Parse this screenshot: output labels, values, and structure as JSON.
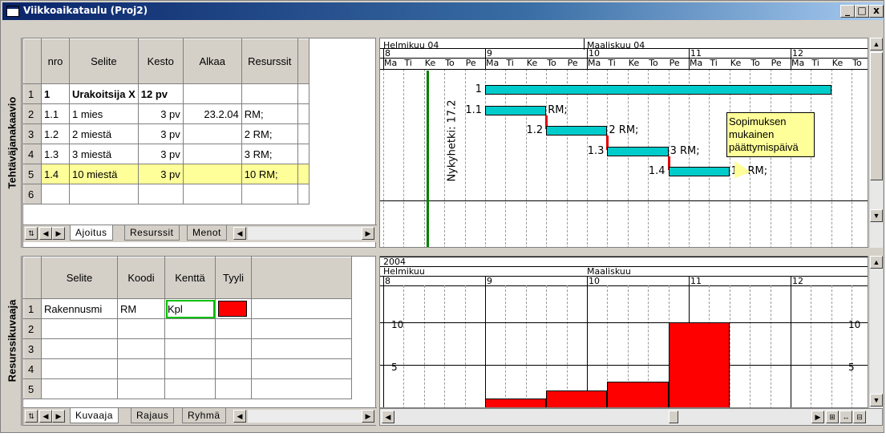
{
  "window": {
    "title": "Viikkoaikataulu (Proj2)",
    "min": "_",
    "max": "□",
    "close": "x"
  },
  "top": {
    "side_label": "Tehtäväjanakaavio",
    "columns": [
      "nro",
      "Selite",
      "Kesto",
      "Alkaa",
      "Resurssit"
    ],
    "rows": [
      {
        "id": "1",
        "nro": "1",
        "selite": "Urakoitsija X",
        "kesto": "12 pv",
        "alkaa": "",
        "res": ""
      },
      {
        "id": "2",
        "nro": "1.1",
        "selite": "1 mies",
        "kesto": "3 pv",
        "alkaa": "23.2.04",
        "res": "RM;"
      },
      {
        "id": "3",
        "nro": "1.2",
        "selite": "2 miestä",
        "kesto": "3 pv",
        "alkaa": "",
        "res": "2 RM;"
      },
      {
        "id": "4",
        "nro": "1.3",
        "selite": "3 miestä",
        "kesto": "3 pv",
        "alkaa": "",
        "res": "3 RM;"
      },
      {
        "id": "5",
        "nro": "1.4",
        "selite": "10 miestä",
        "kesto": "3 pv",
        "alkaa": "",
        "res": "10 RM;"
      },
      {
        "id": "6",
        "nro": "",
        "selite": "",
        "kesto": "",
        "alkaa": "",
        "res": ""
      }
    ],
    "tabs": [
      "Ajoitus",
      "Resurssit",
      "Menot"
    ],
    "gantt": {
      "months": [
        "Helmikuu 04",
        "Maaliskuu 04"
      ],
      "weeks": [
        "8",
        "9",
        "10",
        "11",
        "12"
      ],
      "days": [
        "Ma",
        "Ti",
        "Ke",
        "To",
        "Pe"
      ],
      "now_label": "Nykyhetki: 17.2",
      "bars": [
        {
          "label": "1",
          "res": ""
        },
        {
          "label": "1.1",
          "res": "RM;"
        },
        {
          "label": "1.2",
          "res": "2 RM;"
        },
        {
          "label": "1.3",
          "res": "3 RM;"
        },
        {
          "label": "1.4",
          "res": "10 RM;"
        }
      ],
      "callout": "Sopimuksen mukainen päättymispäivä"
    }
  },
  "bottom": {
    "side_label": "Resurssikuvaaja",
    "columns": [
      "Selite",
      "Koodi",
      "Kenttä",
      "Tyyli"
    ],
    "rows": [
      {
        "id": "1",
        "selite": "Rakennusmi",
        "koodi": "RM",
        "kentta": "Kpl",
        "tyyli_color": "#ff0000"
      },
      {
        "id": "2",
        "selite": "",
        "koodi": "",
        "kentta": ""
      },
      {
        "id": "3",
        "selite": "",
        "koodi": "",
        "kentta": ""
      },
      {
        "id": "4",
        "selite": "",
        "koodi": "",
        "kentta": ""
      },
      {
        "id": "5",
        "selite": "",
        "koodi": "",
        "kentta": ""
      }
    ],
    "tabs": [
      "Kuvaaja",
      "Rajaus",
      "Ryhmä"
    ],
    "chart": {
      "year": "2004",
      "months": [
        "Helmikuu",
        "Maaliskuu"
      ],
      "weeks": [
        "8",
        "9",
        "10",
        "11",
        "12"
      ],
      "ytick_10": "10",
      "ytick_5": "5"
    }
  },
  "chart_data": {
    "type": "bar",
    "categories": [
      "9",
      "10",
      "11"
    ],
    "values": [
      1,
      2,
      3,
      10
    ],
    "ylabel": "",
    "ylim": [
      0,
      12
    ]
  }
}
